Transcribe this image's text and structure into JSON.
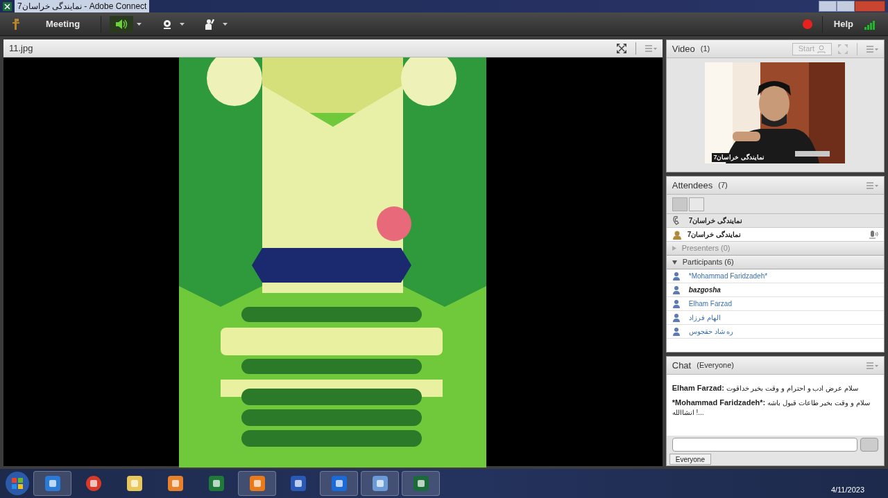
{
  "window": {
    "title": "نمایندگی خراسان7 - Adobe Connect"
  },
  "menubar": {
    "meeting_label": "Meeting",
    "help_label": "Help",
    "audio_on": true
  },
  "share_pod": {
    "title": "11.jpg"
  },
  "video_pod": {
    "title": "Video",
    "count": "(1)",
    "start_label": "Start",
    "caption": "نمایندگی خراسان7"
  },
  "attendees_pod": {
    "title": "Attendees",
    "count": "(7)",
    "hosts": [
      {
        "name": "نمایندگی خراسان7",
        "kind": "phone"
      },
      {
        "name": "نمایندگی خراسان7",
        "kind": "host"
      }
    ],
    "groups": [
      {
        "label": "Presenters (0)",
        "expanded": false
      },
      {
        "label": "Participants (6)",
        "expanded": true,
        "members": [
          {
            "name": "*Mohammad Faridzadeh*",
            "bold": false
          },
          {
            "name": "bazgosha",
            "bold": true
          },
          {
            "name": "Elham Farzad",
            "bold": false
          },
          {
            "name": "الهام فرزاد",
            "bold": false
          },
          {
            "name": "ره شاد حقجوس",
            "bold": false
          }
        ]
      }
    ]
  },
  "chat_pod": {
    "title": "Chat",
    "scope": "(Everyone)",
    "messages": [
      {
        "sender": "Elham Farzad:",
        "text": "سلام عرض ادب و احترام و وقت بخیر خداقوت"
      },
      {
        "sender": "*Mohammad Faridzadeh*:",
        "text": "سلام و وقت بخیر طاعات قبول باشه انشاالله !..."
      }
    ],
    "tab": "Everyone"
  },
  "taskbar": {
    "date": "4/11/2023"
  }
}
